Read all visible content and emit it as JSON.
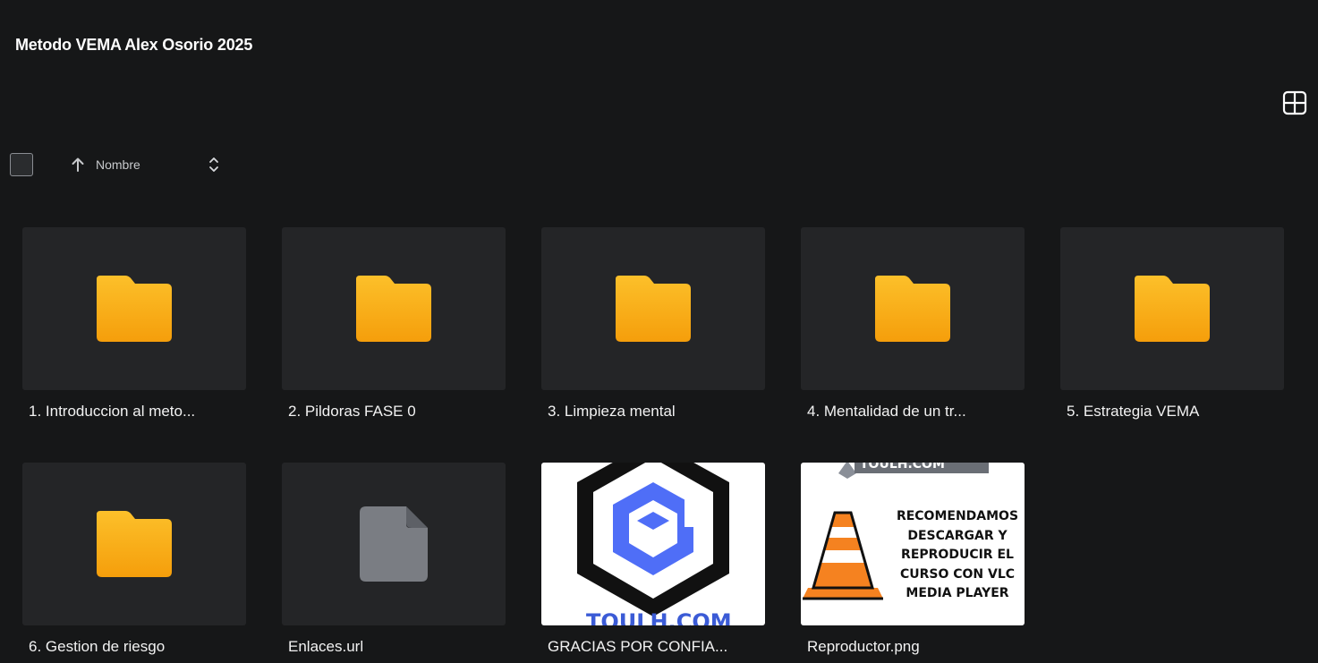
{
  "header": {
    "title": "Metodo VEMA Alex Osorio 2025"
  },
  "toolbar": {
    "sort_label": "Nombre",
    "view_toggle_icon": "grid-view-icon",
    "sort_direction_icon": "arrow-up-icon",
    "sort_toggle_icon": "chevron-up-down-icon"
  },
  "colors": {
    "folder_yellow": "#fbb81f",
    "folder_orange": "#f59e0b",
    "file_gray": "#7a7d83",
    "brand_blue": "#4f6ef7",
    "vlc_orange": "#f58220"
  },
  "items": [
    {
      "label": "1. Introduccion al meto...",
      "type": "folder",
      "icon": "folder-icon"
    },
    {
      "label": "2. Pildoras FASE 0",
      "type": "folder",
      "icon": "folder-icon"
    },
    {
      "label": "3. Limpieza mental",
      "type": "folder",
      "icon": "folder-icon"
    },
    {
      "label": "4. Mentalidad de un tr...",
      "type": "folder",
      "icon": "folder-icon"
    },
    {
      "label": "5. Estrategia VEMA",
      "type": "folder",
      "icon": "folder-icon"
    },
    {
      "label": "6. Gestion de riesgo",
      "type": "folder",
      "icon": "folder-icon"
    },
    {
      "label": "Enlaces.url",
      "type": "file",
      "icon": "file-icon"
    },
    {
      "label": "GRACIAS POR CONFIA...",
      "type": "image",
      "icon": "toulh-logo-thumbnail",
      "thumb_text": "TOULH.COM"
    },
    {
      "label": "Reproductor.png",
      "type": "image",
      "icon": "vlc-thumbnail",
      "thumb_header": "TOULH.COM",
      "thumb_lines": [
        "RECOMENDAMOS",
        "DESCARGAR Y",
        "REPRODUCIR EL",
        "CURSO CON VLC",
        "MEDIA PLAYER"
      ]
    }
  ]
}
